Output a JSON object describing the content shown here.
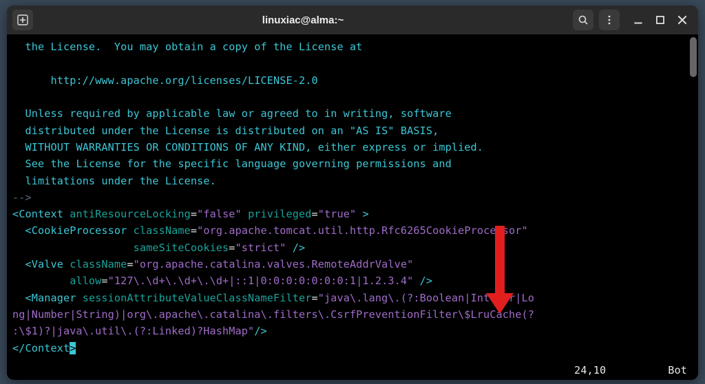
{
  "titlebar": {
    "title": "linuxiac@alma:~"
  },
  "license": {
    "l1": "  the License.  You may obtain a copy of the License at",
    "url": "      http://www.apache.org/licenses/LICENSE-2.0",
    "l2": "  Unless required by applicable law or agreed to in writing, software",
    "l3": "  distributed under the License is distributed on an \"AS IS\" BASIS,",
    "l4": "  WITHOUT WARRANTIES OR CONDITIONS OF ANY KIND, either express or implied.",
    "l5": "  See the License for the specific language governing permissions and",
    "l6": "  limitations under the License.",
    "end": "-->"
  },
  "xml": {
    "context_open": "<Context",
    "attr_antiResourceLocking": "antiResourceLocking",
    "val_false": "\"false\"",
    "attr_privileged": "privileged",
    "val_true": "\"true\"",
    "gt": ">",
    "cookie_open": "<CookieProcessor",
    "attr_className": "className",
    "cookie_class": "\"org.apache.tomcat.util.http.Rfc6265CookieProcessor\"",
    "attr_sameSite": "sameSiteCookies",
    "val_strict": "\"strict\"",
    "selfclose": "/>",
    "valve_open": "<Valve",
    "valve_class": "\"org.apache.catalina.valves.RemoteAddrValve\"",
    "attr_allow": "allow",
    "allow_val": "\"127\\.\\d+\\.\\d+\\.\\d+|::1|0:0:0:0:0:0:0:1|1.2.3.4\"",
    "manager_open": "<Manager",
    "attr_filter": "sessionAttributeValueClassNameFilter",
    "filter_val_a": "\"java\\.lang\\.(?:Boolean|Integer|Lo",
    "filter_val_b": "ng|Number|String)|org\\.apache\\.catalina\\.filters\\.CsrfPreventionFilter\\$LruCache(?",
    "filter_val_c": ":\\$1)?|java\\.util\\.(?:Linked)?HashMap\"",
    "context_close": "</Context",
    "close_gt": ">"
  },
  "status": {
    "pos": "24,10",
    "loc": "Bot"
  }
}
